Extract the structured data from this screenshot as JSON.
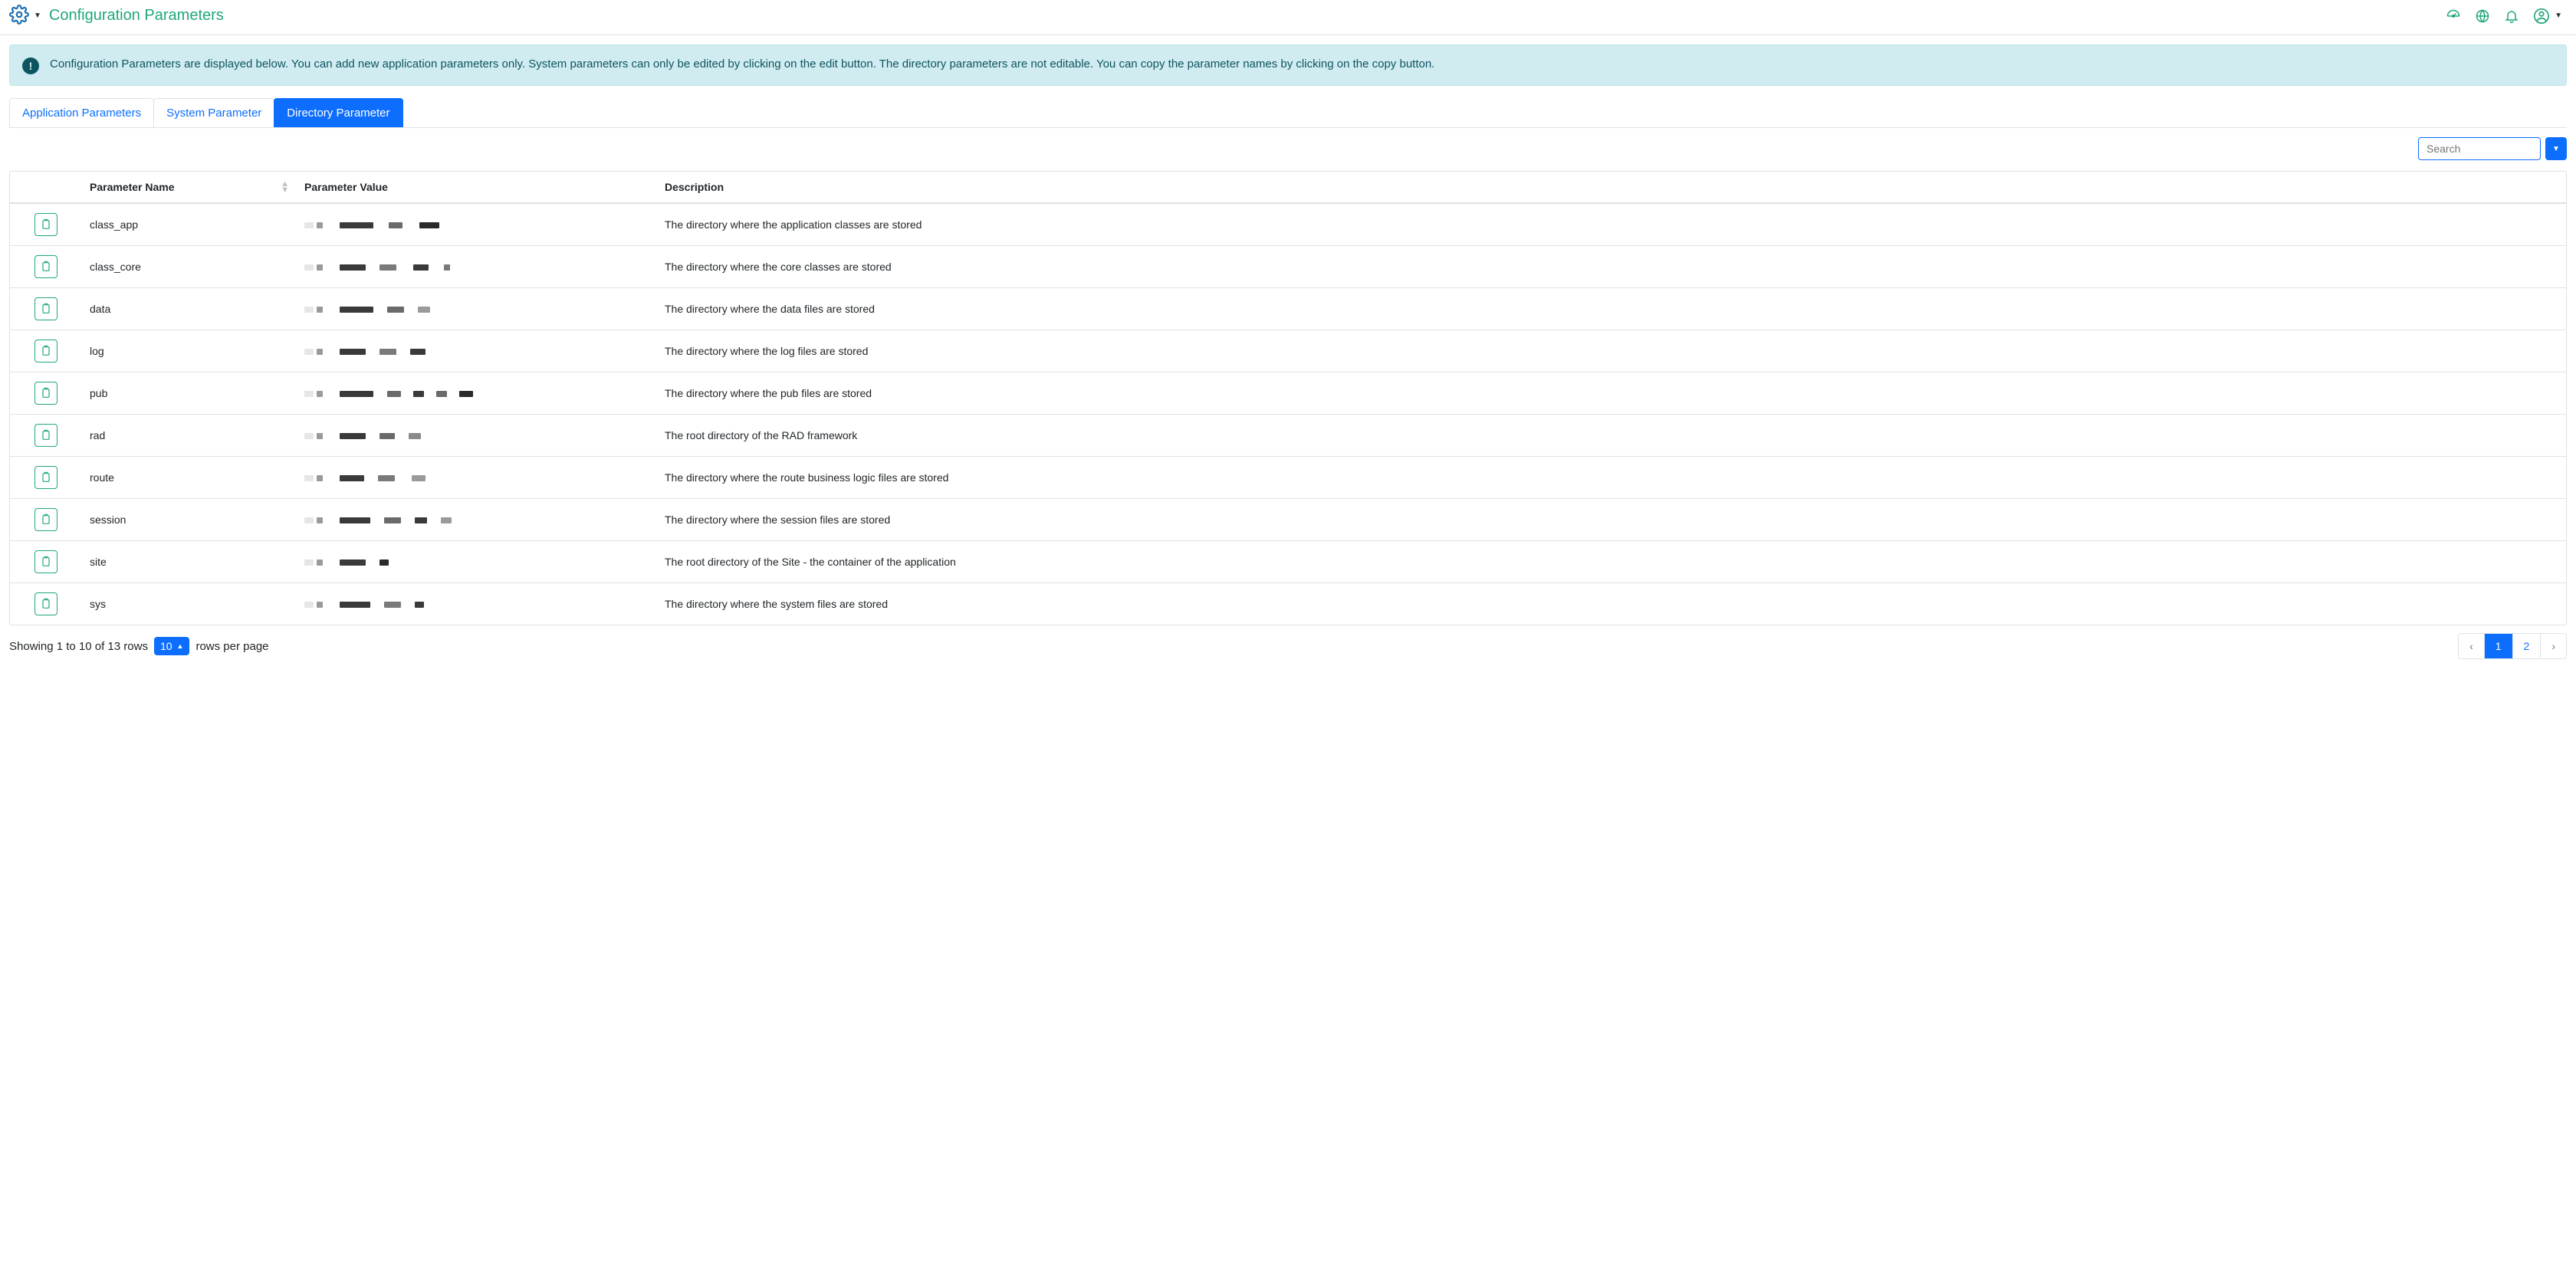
{
  "header": {
    "title": "Configuration Parameters"
  },
  "alert": {
    "text": "Configuration Parameters are displayed below. You can add new application parameters only. System parameters can only be edited by clicking on the edit button. The directory parameters are not editable. You can copy the parameter names by clicking on the copy button."
  },
  "tabs": {
    "application": "Application Parameters",
    "system": "System Parameter",
    "directory": "Directory Parameter"
  },
  "search": {
    "placeholder": "Search"
  },
  "table": {
    "headers": {
      "name": "Parameter Name",
      "value": "Parameter Value",
      "description": "Description"
    },
    "rows": [
      {
        "name": "class_app",
        "description": "The directory where the application classes are stored"
      },
      {
        "name": "class_core",
        "description": "The directory where the core classes are stored"
      },
      {
        "name": "data",
        "description": "The directory where the data files are stored"
      },
      {
        "name": "log",
        "description": "The directory where the log files are stored"
      },
      {
        "name": "pub",
        "description": "The directory where the pub files are stored"
      },
      {
        "name": "rad",
        "description": "The root directory of the RAD framework"
      },
      {
        "name": "route",
        "description": "The directory where the route business logic files are stored"
      },
      {
        "name": "session",
        "description": "The directory where the session files are stored"
      },
      {
        "name": "site",
        "description": "The root directory of the Site - the container of the application"
      },
      {
        "name": "sys",
        "description": "The directory where the system files are stored"
      }
    ]
  },
  "footer": {
    "showing_prefix": "Showing 1 to 10 of 13 rows",
    "rows_per_page_value": "10",
    "rows_per_page_suffix": "rows per page",
    "pages": {
      "prev": "‹",
      "p1": "1",
      "p2": "2",
      "next": "›"
    }
  }
}
